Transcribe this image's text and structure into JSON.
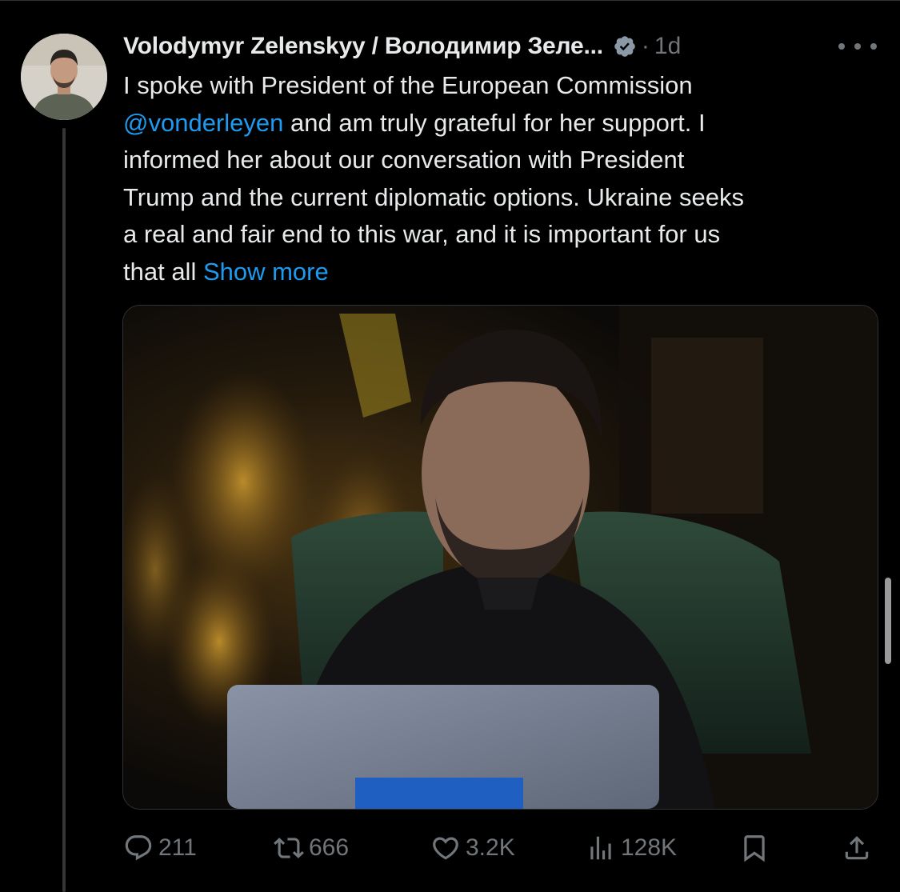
{
  "tweet": {
    "display_name": "Volodymyr Zelenskyy / Володимир Зеле...",
    "separator": "·",
    "time": "1d",
    "text_lines": [
      {
        "parts": [
          {
            "text": "I spoke with President of the European Commission",
            "type": "text"
          }
        ]
      },
      {
        "parts": [
          {
            "text": "@vonderleyen",
            "type": "mention"
          },
          {
            "text": " and am truly grateful for her support. I",
            "type": "text"
          }
        ]
      },
      {
        "parts": [
          {
            "text": "informed her about our conversation with President",
            "type": "text"
          }
        ]
      },
      {
        "parts": [
          {
            "text": "Trump and the current diplomatic options. Ukraine seeks",
            "type": "text"
          }
        ]
      },
      {
        "parts": [
          {
            "text": "a real and fair end to this war, and it is important for us",
            "type": "text"
          }
        ]
      },
      {
        "parts": [
          {
            "text": "that all ",
            "type": "text"
          },
          {
            "text": "Show more",
            "type": "link"
          }
        ]
      }
    ]
  },
  "actions": {
    "replies": "211",
    "reposts": "666",
    "likes": "3.2K",
    "views": "128K"
  },
  "colors": {
    "accent": "#1d9bf0",
    "muted": "#71767b",
    "text": "#e7e9ea",
    "background": "#000000"
  },
  "icons": {
    "reply": "reply-icon",
    "repost": "repost-icon",
    "like": "heart-icon",
    "views": "views-icon",
    "bookmark": "bookmark-icon",
    "share": "share-icon",
    "verified": "verified-badge-icon",
    "more": "more-dots-icon"
  }
}
